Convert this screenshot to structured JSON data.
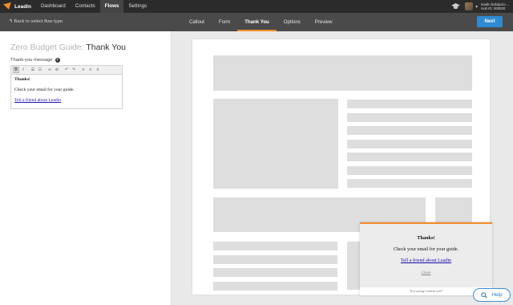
{
  "app": {
    "brand": "Leadin",
    "nav": [
      "Dashboard",
      "Contacts",
      "Flows",
      "Settings"
    ],
    "active_nav": "Flows",
    "account_email": "leadin.hubspot.c...",
    "hub_id": "Hub ID: 000030"
  },
  "subnav": {
    "back": "Back to select flow type",
    "tabs": [
      "Callout",
      "Form",
      "Thank You",
      "Options",
      "Preview"
    ],
    "active_tab": "Thank You",
    "next": "Next"
  },
  "editor": {
    "title_light": "Zero Budget Guide:",
    "title_strong": "Thank You",
    "label": "Thank-you message",
    "help_glyph": "?",
    "toolbar": [
      {
        "icon": "bold-icon",
        "glyph": "B"
      },
      {
        "icon": "italic-icon",
        "glyph": "I"
      },
      {
        "icon": "bulleted-list-icon",
        "glyph": "☰"
      },
      {
        "icon": "numbered-list-icon",
        "glyph": "☷"
      },
      {
        "icon": "link-icon",
        "glyph": "∞"
      },
      {
        "icon": "unlink-icon",
        "glyph": "⊘"
      },
      {
        "icon": "undo-icon",
        "glyph": "↶"
      },
      {
        "icon": "redo-icon",
        "glyph": "↷"
      },
      {
        "icon": "align-left-icon",
        "glyph": "≡"
      },
      {
        "icon": "align-center-icon",
        "glyph": "≡"
      },
      {
        "icon": "align-right-icon",
        "glyph": "≡"
      }
    ],
    "heading": "Thanks!",
    "body": "Check your email for your guide.",
    "link": "Tell a friend about Leadin"
  },
  "popup": {
    "title": "Thanks!",
    "body": "Check your email for your guide.",
    "link": "Tell a friend about Leadin",
    "close": "Close",
    "footer": "Not using Leadin yet?"
  },
  "help": {
    "label": "Help"
  },
  "colors": {
    "accent": "#f28c28",
    "primary": "#2f8ad1",
    "topnav": "#2b2b2b",
    "subnav": "#4a4a4a"
  }
}
